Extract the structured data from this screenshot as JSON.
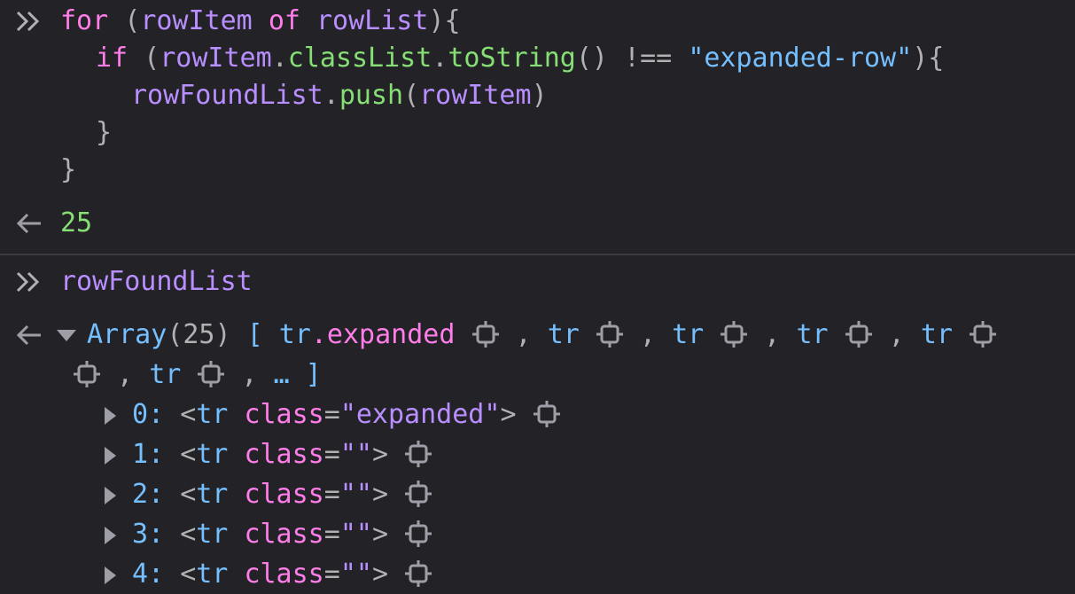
{
  "console": {
    "input1": {
      "l1": {
        "kw_for": "for",
        "p1": " (",
        "var1": "rowItem",
        "sp1": " ",
        "kw_of": "of",
        "sp2": " ",
        "var2": "rowList",
        "p2": "){"
      },
      "l2": {
        "kw_if": "if",
        "p1": " (",
        "var1": "rowItem",
        "dot1": ".",
        "fn1": "classList",
        "dot2": ".",
        "fn2": "toString",
        "p2": "() !== ",
        "str": "\"expanded-row\"",
        "p3": "){"
      },
      "l3": {
        "var1": "rowFoundList",
        "dot": ".",
        "fn": "push",
        "p1": "(",
        "var2": "rowItem",
        "p2": ")"
      },
      "l4": "}",
      "l5": "}"
    },
    "result1": "25",
    "input2": "rowFoundList",
    "array": {
      "label": "Array",
      "count": "(25)",
      "open": " [ ",
      "first_tag": "tr",
      "first_cls": ".expanded",
      "tr": "tr",
      "comma": " , ",
      "more": "… ]",
      "items": [
        {
          "index": "0:",
          "lt": "<",
          "tag": "tr",
          "attr": "class",
          "eq": "=",
          "val": "\"expanded\"",
          "gt": ">"
        },
        {
          "index": "1:",
          "lt": "<",
          "tag": "tr",
          "attr": "class",
          "eq": "=",
          "val": "\"\"",
          "gt": ">"
        },
        {
          "index": "2:",
          "lt": "<",
          "tag": "tr",
          "attr": "class",
          "eq": "=",
          "val": "\"\"",
          "gt": ">"
        },
        {
          "index": "3:",
          "lt": "<",
          "tag": "tr",
          "attr": "class",
          "eq": "=",
          "val": "\"\"",
          "gt": ">"
        },
        {
          "index": "4:",
          "lt": "<",
          "tag": "tr",
          "attr": "class",
          "eq": "=",
          "val": "\"\"",
          "gt": ">"
        }
      ]
    }
  },
  "icons": {
    "prompt": "double-chevron-right-icon",
    "result": "left-arrow-icon",
    "node": "crosshair-icon",
    "expand": "triangle-icon"
  },
  "colors": {
    "background": "#232327",
    "keyword": "#ff7de9",
    "identifier": "#b98eff",
    "function": "#86de74",
    "string": "#75bfff",
    "number": "#86de74",
    "text": "#b1b1b3"
  }
}
